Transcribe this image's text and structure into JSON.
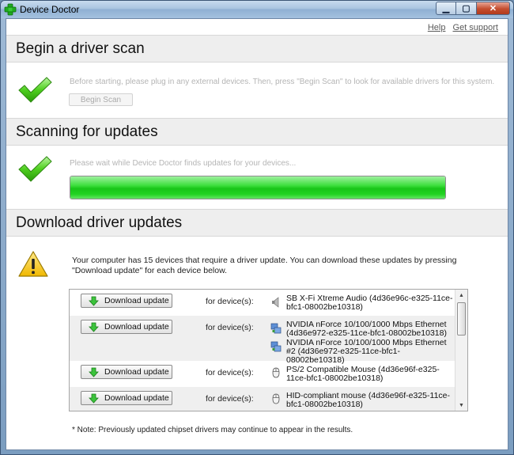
{
  "window": {
    "title": "Device Doctor",
    "icon": "green-cross-icon"
  },
  "caption": {
    "minimize": "▁",
    "maximize": "▢",
    "close": "✕"
  },
  "links": {
    "help": "Help",
    "support": "Get support"
  },
  "scan": {
    "title": "Begin a driver scan",
    "description": "Before starting, please plug in any external devices. Then, press \"Begin Scan\" to look for available drivers for this system.",
    "button": "Begin Scan"
  },
  "scanning": {
    "title": "Scanning for updates",
    "description": "Please wait while Device Doctor finds updates for your devices...",
    "progress": 1.0
  },
  "download": {
    "title": "Download driver updates",
    "message": "Your computer has 15 devices that require a driver update. You can download these updates by pressing \"Download update\" for each device below.",
    "button_label": "Download update",
    "for_label": "for device(s):",
    "rows": [
      {
        "devices": [
          {
            "icon": "speaker-icon",
            "name": "SB X-Fi Xtreme Audio (4d36e96c-e325-11ce-bfc1-08002be10318)"
          }
        ]
      },
      {
        "devices": [
          {
            "icon": "network-icon",
            "name": "NVIDIA nForce 10/100/1000 Mbps Ethernet (4d36e972-e325-11ce-bfc1-08002be10318)"
          },
          {
            "icon": "network-icon",
            "name": "NVIDIA nForce 10/100/1000 Mbps Ethernet #2 (4d36e972-e325-11ce-bfc1-08002be10318)"
          }
        ]
      },
      {
        "devices": [
          {
            "icon": "mouse-icon",
            "name": "PS/2 Compatible Mouse (4d36e96f-e325-11ce-bfc1-08002be10318)"
          }
        ]
      },
      {
        "devices": [
          {
            "icon": "mouse-icon",
            "name": "HID-compliant mouse (4d36e96f-e325-11ce-bfc1-08002be10318)"
          }
        ]
      }
    ]
  },
  "note": "* Note: Previously updated chipset drivers may continue to appear in the results.",
  "colors": {
    "accent": "#22cc22",
    "warning": "#f5c400"
  }
}
